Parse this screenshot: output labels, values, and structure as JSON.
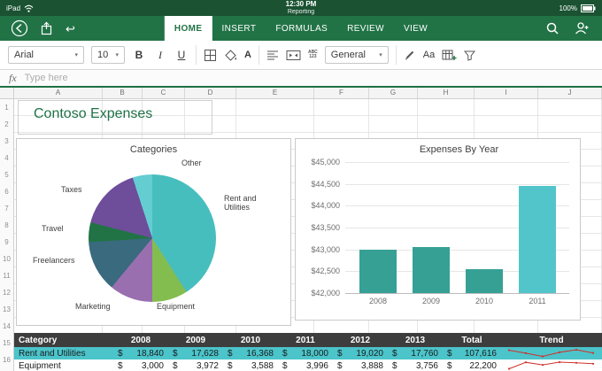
{
  "status_bar": {
    "device": "iPad",
    "time": "12:30 PM",
    "doc_title": "Reporting",
    "battery": "100%"
  },
  "ribbon": {
    "tabs": [
      {
        "label": "HOME",
        "active": true
      },
      {
        "label": "INSERT",
        "active": false
      },
      {
        "label": "FORMULAS",
        "active": false
      },
      {
        "label": "REVIEW",
        "active": false
      },
      {
        "label": "VIEW",
        "active": false
      }
    ]
  },
  "toolbar": {
    "font_name": "Arial",
    "font_size": "10",
    "bold": "B",
    "italic": "I",
    "underline": "U",
    "font_color_letter": "A",
    "abc": "ABC",
    "num123": "123",
    "number_format": "General",
    "styles_label": "Aa"
  },
  "formula_bar": {
    "fx": "fx",
    "placeholder": "Type here"
  },
  "grid": {
    "title": "Contoso Expenses",
    "columns": [
      "A",
      "B",
      "C",
      "D",
      "E",
      "F",
      "G",
      "H",
      "I",
      "J"
    ],
    "rows": [
      "1",
      "2",
      "3",
      "4",
      "5",
      "6",
      "7",
      "8",
      "9",
      "10",
      "11",
      "12",
      "13",
      "14",
      "15",
      "16"
    ]
  },
  "colors": {
    "brand_green": "#217346",
    "selection_teal": "#4BC4CA",
    "trend_red": "#D0312D"
  },
  "chart_data": [
    {
      "type": "pie",
      "title": "Categories",
      "segments": [
        {
          "label": "Rent and Utilities",
          "value": 41,
          "color": "#47BEBE"
        },
        {
          "label": "Equipment",
          "value": 9,
          "color": "#84BD4F"
        },
        {
          "label": "Marketing",
          "value": 11,
          "color": "#9A6FB0"
        },
        {
          "label": "Freelancers",
          "value": 13,
          "color": "#3A6A7E"
        },
        {
          "label": "Travel",
          "value": 5,
          "color": "#217346"
        },
        {
          "label": "Taxes",
          "value": 16,
          "color": "#6E4D9B"
        },
        {
          "label": "Other",
          "value": 5,
          "color": "#63CDD2"
        }
      ]
    },
    {
      "type": "bar",
      "title": "Expenses By Year",
      "categories": [
        "2008",
        "2009",
        "2010",
        "2011"
      ],
      "values": [
        43000,
        43050,
        42550,
        44450
      ],
      "bar_colors": [
        "#37A095",
        "#37A095",
        "#37A095",
        "#52C5CB"
      ],
      "ylim": [
        42000,
        45000
      ],
      "yticks": [
        "$45,000",
        "$44,500",
        "$44,000",
        "$43,500",
        "$43,000",
        "$42,500",
        "$42,000"
      ],
      "grid": true,
      "legend": false
    }
  ],
  "table": {
    "headers": [
      "Category",
      "2008",
      "2009",
      "2010",
      "2011",
      "2012",
      "2013",
      "Total",
      "Trend"
    ],
    "currency": "$",
    "trend_color": "#D0312D",
    "rows": [
      {
        "label": "Rent and Utilities",
        "values": [
          "18,840",
          "17,628",
          "16,368",
          "18,000",
          "19,020",
          "17,760"
        ],
        "total": "107,616",
        "selected": true
      },
      {
        "label": "Equipment",
        "values": [
          "3,000",
          "3,972",
          "3,588",
          "3,996",
          "3,888",
          "3,756"
        ],
        "total": "22,200",
        "selected": false
      }
    ]
  }
}
